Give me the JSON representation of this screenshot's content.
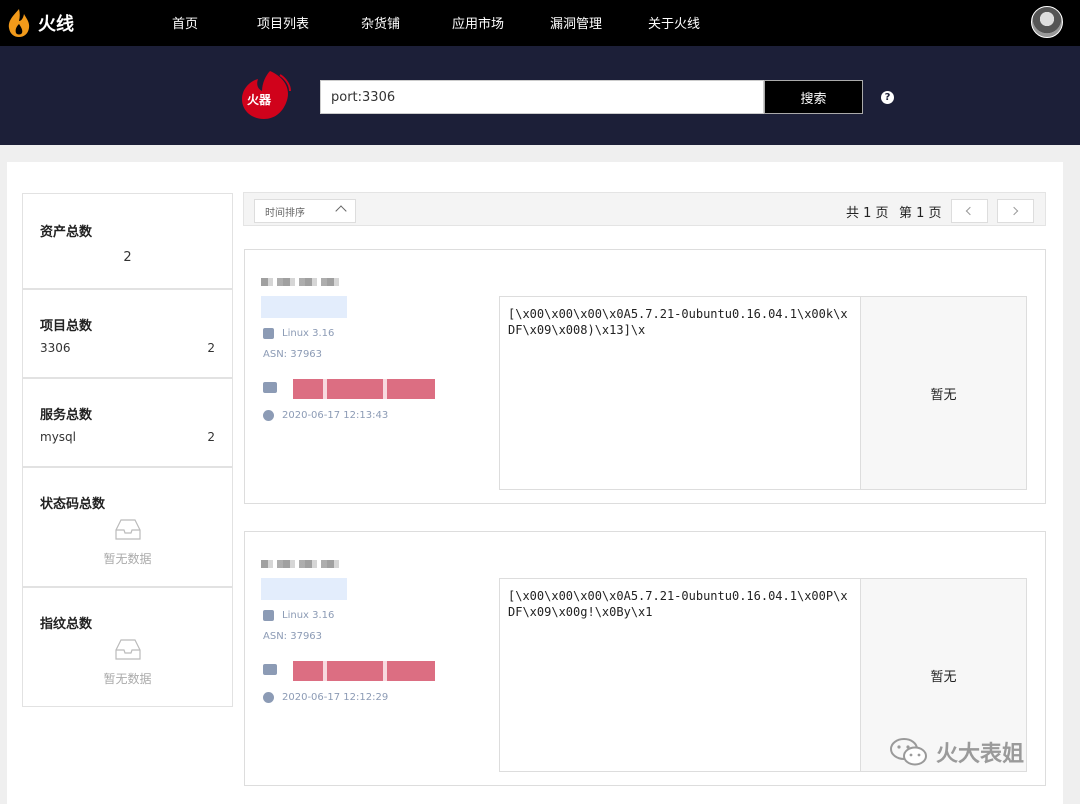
{
  "nav": {
    "brand": "火线",
    "items": [
      "首页",
      "项目列表",
      "杂货铺",
      "应用市场",
      "漏洞管理",
      "关于火线"
    ]
  },
  "search": {
    "value": "port:3306",
    "button_label": "搜索",
    "help": "?",
    "logo_text": "火器"
  },
  "stats": [
    {
      "title": "资产总数",
      "value": "2"
    },
    {
      "title": "项目总数",
      "row_label": "3306",
      "row_count": "2"
    },
    {
      "title": "服务总数",
      "row_label": "mysql",
      "row_count": "2"
    },
    {
      "title": "状态码总数",
      "empty": "暂无数据"
    },
    {
      "title": "指纹总数",
      "empty": "暂无数据"
    }
  ],
  "toolbar": {
    "sort_label": "时间排序",
    "total_pages": "共 1 页",
    "current_page": "第 1 页"
  },
  "results": [
    {
      "os": "Linux 3.16",
      "asn": "ASN: 37963",
      "time": "2020-06-17 12:13:43",
      "banner": "[\\x00\\x00\\x00\\x0A5.7.21-0ubuntu0.16.04.1\\x00k\\xDF\\x09\\x008)\\x13]\\x",
      "cert": "暂无"
    },
    {
      "os": "Linux 3.16",
      "asn": "ASN: 37963",
      "time": "2020-06-17 12:12:29",
      "banner": "[\\x00\\x00\\x00\\x0A5.7.21-0ubuntu0.16.04.1\\x00P\\xDF\\x09\\x00g!\\x0By\\x1",
      "cert": "暂无"
    }
  ],
  "watermark": "火大表姐",
  "colors": {
    "nav_bg": "#000000",
    "band_bg": "#1c1f38",
    "accent_red": "#d0021b",
    "meta_text": "#8c9bb5"
  }
}
